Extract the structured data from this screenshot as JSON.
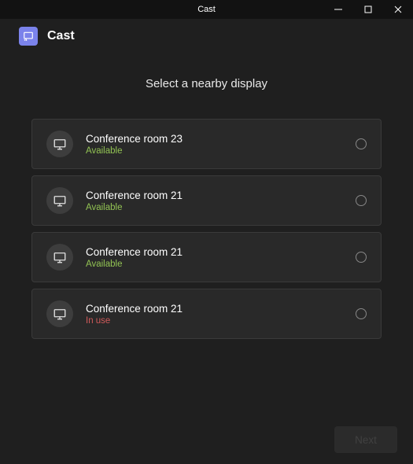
{
  "titlebar": {
    "title": "Cast"
  },
  "header": {
    "title": "Cast"
  },
  "subtitle": "Select a nearby display",
  "devices": [
    {
      "name": "Conference room 23",
      "status": "Available",
      "statusClass": "status-available"
    },
    {
      "name": "Conference room 21",
      "status": "Available",
      "statusClass": "status-available"
    },
    {
      "name": "Conference room 21",
      "status": "Available",
      "statusClass": "status-available"
    },
    {
      "name": "Conference room 21",
      "status": "In use",
      "statusClass": "status-inuse"
    }
  ],
  "footer": {
    "nextLabel": "Next"
  }
}
